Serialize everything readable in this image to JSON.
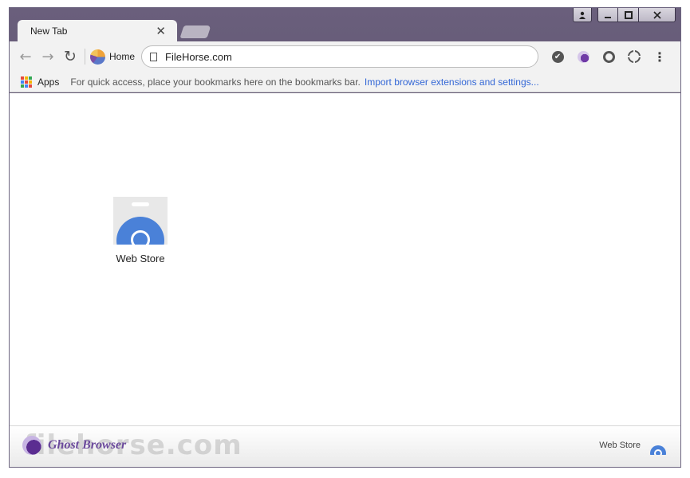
{
  "window": {
    "controls": {
      "user_icon": "user-icon",
      "minimize_icon": "minimize-icon",
      "maximize_icon": "maximize-icon",
      "close_icon": "close-icon"
    }
  },
  "tabs": [
    {
      "title": "New Tab",
      "close_glyph": "✕"
    }
  ],
  "toolbar": {
    "back_glyph": "←",
    "forward_glyph": "→",
    "reload_glyph": "↻",
    "home_label": "Home",
    "address_value": "FileHorse.com",
    "menu_glyph": "⋮",
    "check_glyph": "✔"
  },
  "bookmarks_bar": {
    "apps_label": "Apps",
    "hint": "For quick access, place your bookmarks here on the bookmarks bar.",
    "import_link": "Import browser extensions and settings..."
  },
  "content": {
    "tiles": [
      {
        "label": "Web Store"
      }
    ]
  },
  "footer": {
    "brand_name": "Ghost Browser",
    "watermark": "filehorse.com",
    "web_store_link": "Web Store"
  },
  "colors": {
    "frame": "#5e5470",
    "accent_link": "#3367d6",
    "webstore_blue": "#4a81d8",
    "brand_purple": "#6b4a9c"
  }
}
